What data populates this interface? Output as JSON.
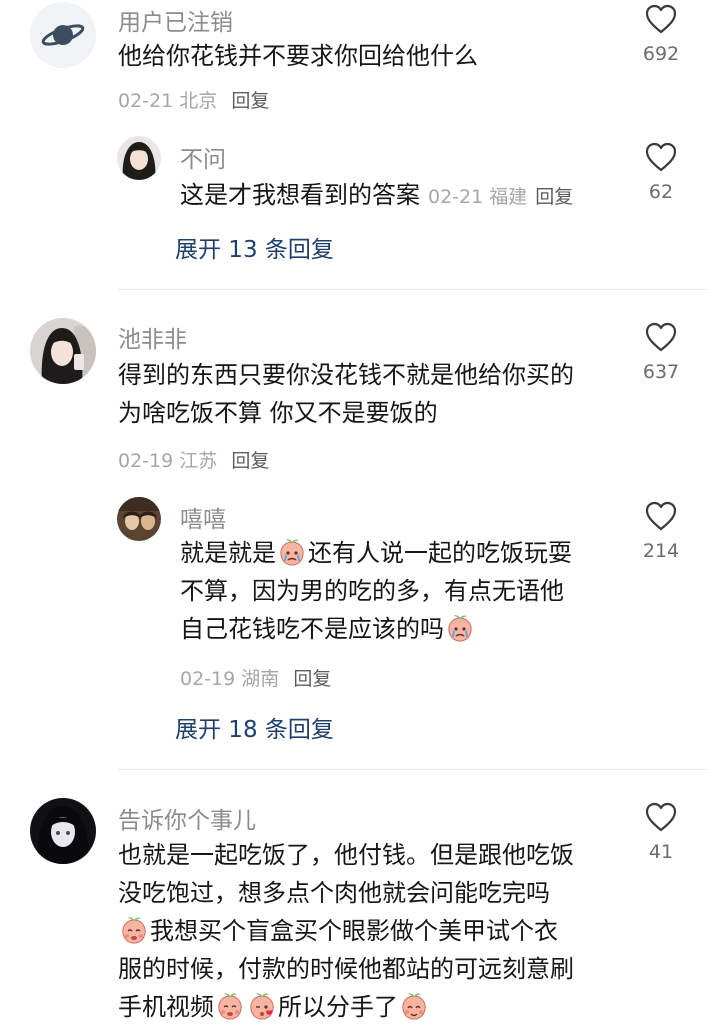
{
  "comments": [
    {
      "author": "用户已注销",
      "text": "他给你花钱并不要求你回给他什么",
      "date": "02-21",
      "location": "北京",
      "reply_label": "回复",
      "likes": "692",
      "replies": [
        {
          "author": "不问",
          "text": "这是才我想看到的答案",
          "date": "02-21",
          "location": "福建",
          "reply_label": "回复",
          "likes": "62"
        }
      ],
      "expand": "展开 13 条回复"
    },
    {
      "author": "池非非",
      "text_lines": [
        "得到的东西只要你没花钱不就是他给你买的",
        "为啥吃饭不算 你又不是要饭的"
      ],
      "date": "02-19",
      "location": "江苏",
      "reply_label": "回复",
      "likes": "637",
      "replies": [
        {
          "author": "嘻嘻",
          "text_segments": [
            "就是就是",
            "还有人说一起的吃饭玩耍",
            "不算，因为男的吃的多，有点无语他",
            "自己花钱吃不是应该的吗"
          ],
          "date": "02-19",
          "location": "湖南",
          "reply_label": "回复",
          "likes": "214"
        }
      ],
      "expand": "展开 18 条回复"
    },
    {
      "author": "告诉你个事儿",
      "text_segments": [
        "也就是一起吃饭了，他付钱。但是跟他吃饭",
        "没吃饱过，想多点个肉他就会问能吃完吗",
        "我想买个盲盒买个眼影做个美甲试个衣",
        "服的时候，付款的时候他都站的可远刻意刷",
        "手机视频",
        "所以分手了"
      ],
      "likes": "41"
    }
  ],
  "icons": {
    "like": "heart-outline-icon",
    "emoji_cry": "crying-peach-emoji",
    "emoji_kiss": "kissing-peach-emoji",
    "emoji_shy": "shy-peach-emoji"
  },
  "colors": {
    "name": "#8c8c8c",
    "meta": "#a6a6a6",
    "expand": "#1f3f6e",
    "divider": "#ececec"
  }
}
